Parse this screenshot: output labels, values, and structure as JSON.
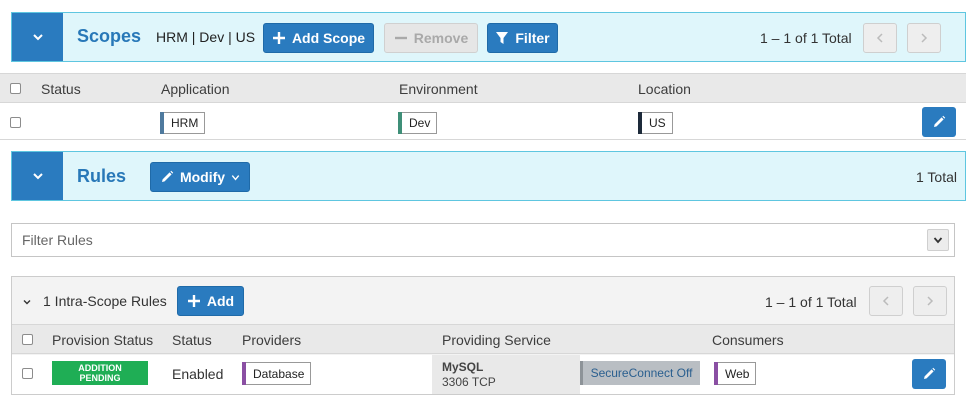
{
  "scopes": {
    "title": "Scopes",
    "scope_summary": "HRM | Dev | US",
    "add_label": "Add Scope",
    "remove_label": "Remove",
    "filter_label": "Filter",
    "pager_text": "1 – 1 of 1 Total",
    "columns": [
      "Status",
      "Application",
      "Environment",
      "Location"
    ],
    "row": {
      "application": "HRM",
      "environment": "Dev",
      "location": "US"
    }
  },
  "rules": {
    "title": "Rules",
    "modify_label": "Modify",
    "total_text": "1 Total",
    "filter_placeholder": "Filter Rules",
    "intra": {
      "title": "1 Intra-Scope Rules",
      "add_label": "Add",
      "pager_text": "1 – 1 of 1 Total",
      "columns": [
        "Provision Status",
        "Status",
        "Providers",
        "Providing Service",
        "Consumers"
      ],
      "row": {
        "provision_line1": "ADDITION",
        "provision_line2": "PENDING",
        "status": "Enabled",
        "provider": "Database",
        "service_name": "MySQL",
        "service_port": "3306 TCP",
        "secure_connect": "SecureConnect Off",
        "consumer": "Web"
      }
    }
  },
  "colors": {
    "accent": "#2a7bbf",
    "header_bg": "#dff6fb",
    "header_border": "#5ec6e0",
    "app_label": "#4f7a9e",
    "env_label": "#3f8f78",
    "loc_label": "#1d2a3a",
    "role_label": "#8a4fa3",
    "pending_green": "#1fae55"
  },
  "icons": [
    "chevron-down-icon",
    "plus-icon",
    "minus-icon",
    "filter-icon",
    "chevron-left-icon",
    "chevron-right-icon",
    "pencil-icon"
  ]
}
